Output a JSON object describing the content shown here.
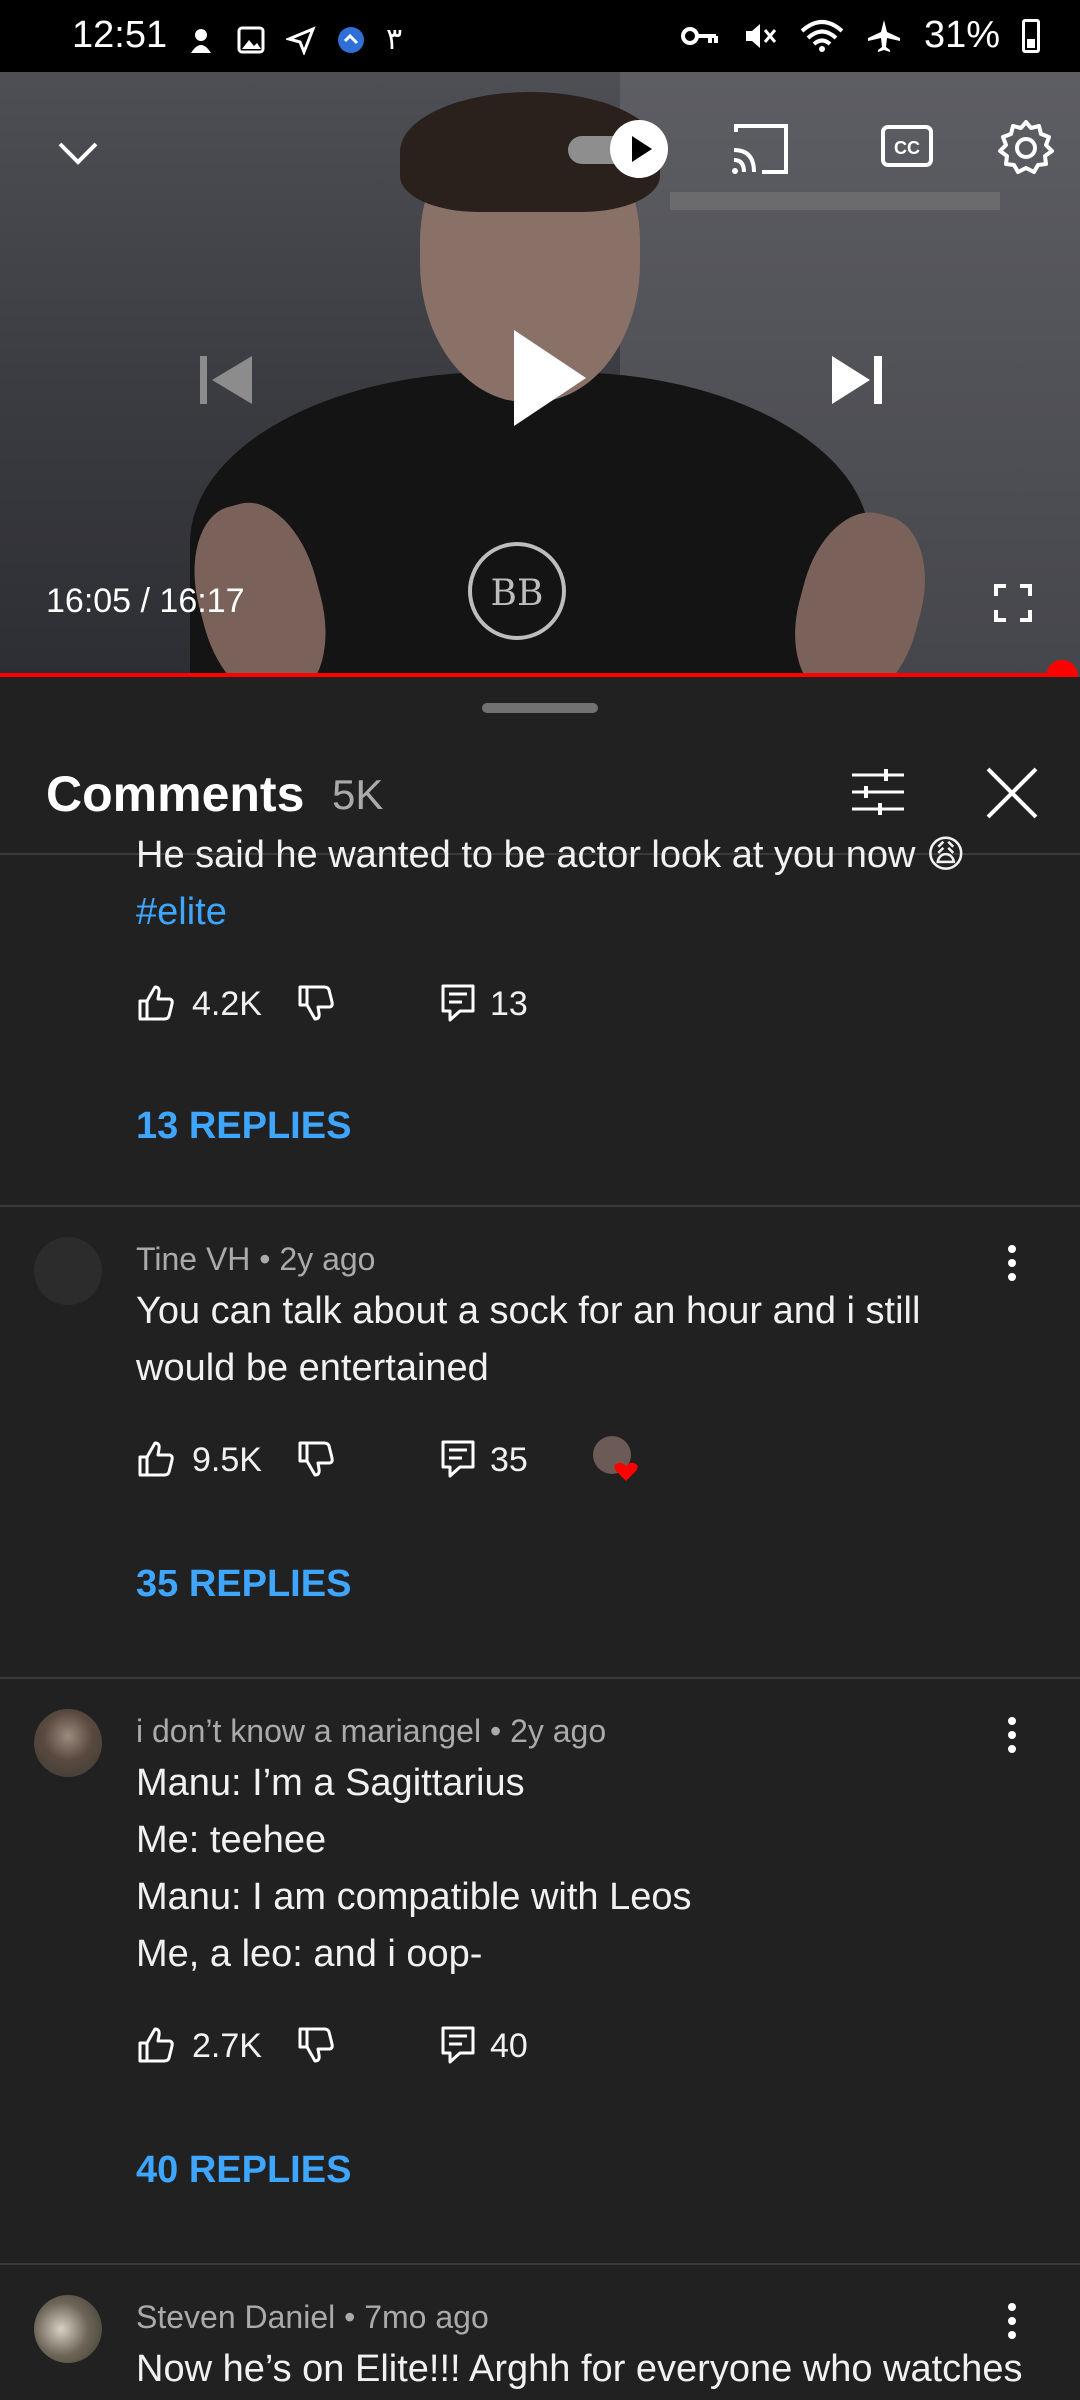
{
  "status_bar": {
    "time": "12:51",
    "extra": "٣",
    "battery": "31%"
  },
  "video": {
    "time": "16:05 / 16:17",
    "progress": 0.988,
    "autoplay_on": true
  },
  "comments_header": {
    "title": "Comments",
    "count": "5K"
  },
  "threads": [
    {
      "text": "He said he wanted to be actor look at you now 😩",
      "hashtag": "#elite",
      "likes": "4.2K",
      "reply_count": "13",
      "replies_label": "13 REPLIES"
    },
    {
      "author": "Tine VH",
      "age": "2y ago",
      "meta": "Tine VH • 2y ago",
      "lines": [
        "You can talk about a sock for an hour and i still",
        "would be entertained"
      ],
      "likes": "9.5K",
      "reply_count": "35",
      "replies_label": "35 REPLIES"
    },
    {
      "author": "i don’t know a mariangel",
      "age": "2y ago",
      "meta": "i don’t know a mariangel • 2y ago",
      "lines": [
        "Manu: I’m a Sagittarius",
        "Me: teehee",
        "Manu: I am compatible with Leos",
        "Me, a leo: and i oop-"
      ],
      "likes": "2.7K",
      "reply_count": "40",
      "replies_label": "40 REPLIES"
    },
    {
      "author": "Steven Daniel",
      "age": "7mo ago",
      "meta": "Steven Daniel • 7mo ago",
      "lines": [
        "Now he’s on Elite!!! Arghh for everyone who watches"
      ]
    }
  ],
  "colors": {
    "link": "#3ea6ff",
    "progress": "#ff0000",
    "background": "#212121"
  }
}
